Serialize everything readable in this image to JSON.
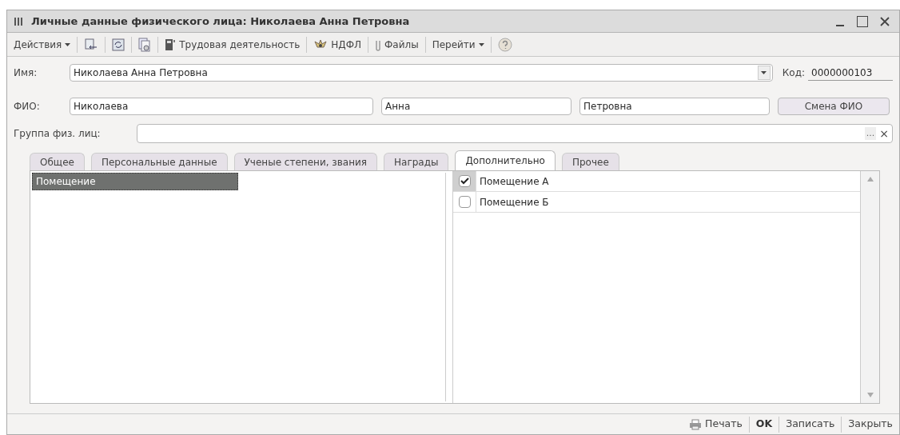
{
  "window": {
    "title": "Личные данные физического лица: Николаева Анна Петровна"
  },
  "toolbar": [
    {
      "kind": "menu",
      "label": "Действия"
    },
    {
      "kind": "icon"
    },
    {
      "kind": "icon"
    },
    {
      "kind": "icon"
    },
    {
      "kind": "button",
      "label": "Трудовая деятельность"
    },
    {
      "kind": "button",
      "label": "НДФЛ"
    },
    {
      "kind": "button",
      "label": "Файлы"
    },
    {
      "kind": "menu",
      "label": "Перейти"
    },
    {
      "kind": "icon"
    }
  ],
  "name_field": {
    "label": "Имя:",
    "value": "Николаева Анна Петровна"
  },
  "code_field": {
    "label": "Код:",
    "value": "0000000103"
  },
  "fio": {
    "label": "ФИО:",
    "surname": "Николаева",
    "first_name": "Анна",
    "patronymic": "Петровна",
    "button": "Смена ФИО"
  },
  "group_field": {
    "label": "Группа физ. лиц:",
    "select_button": "...",
    "clear_button": "×"
  },
  "tabs": [
    {
      "label": "Общее",
      "selected": false
    },
    {
      "label": "Персональные данные",
      "selected": false
    },
    {
      "label": "Ученые степени, звания",
      "selected": false
    },
    {
      "label": "Награды",
      "selected": false
    },
    {
      "label": "Дополнительно",
      "selected": true
    },
    {
      "label": "Прочее",
      "selected": false
    }
  ],
  "left_list": [
    {
      "label": "Помещение",
      "selected": true
    }
  ],
  "right_list": [
    {
      "label": "Помещение А",
      "checked": true
    },
    {
      "label": "Помещение Б",
      "checked": false
    }
  ],
  "footer": [
    {
      "kind": "print",
      "label": "Печать"
    },
    {
      "kind": "bold",
      "label": "OK"
    },
    {
      "kind": "plain",
      "label": "Записать"
    },
    {
      "kind": "plain",
      "label": "Закрыть"
    }
  ]
}
